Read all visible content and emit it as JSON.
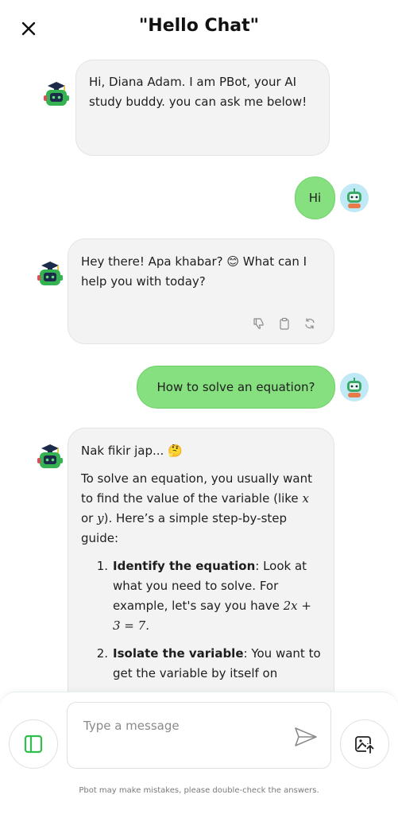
{
  "header": {
    "title": "\"Hello Chat\""
  },
  "messages": {
    "bot1": {
      "text": "Hi, Diana Adam. I am PBot, your AI study buddy.  you can ask me below!"
    },
    "user1": {
      "text": "Hi"
    },
    "bot2": {
      "text": "Hey there! Apa khabar? 😊 What can I help you with today?"
    },
    "user2": {
      "text": "How to solve an equation?"
    },
    "bot3": {
      "thinking": "Nak fikir jap... 🤔",
      "intro_a": "To solve an equation, you usually want to find the value of the variable (like ",
      "var_x": "x",
      "or": " or ",
      "var_y": "y",
      "intro_b": "). Here’s a simple step-by-step guide:",
      "steps": [
        {
          "num": "1.",
          "title": "Identify the equation",
          "body": ": Look at what you need to solve. For example, let's say you have ",
          "equation": "2x + 3 = 7."
        },
        {
          "num": "2.",
          "title": "Isolate the variable",
          "body": ": You want to get the variable by itself on"
        }
      ]
    }
  },
  "composer": {
    "placeholder": "Type a message",
    "disclaimer": "Pbot may make mistakes, please double-check the answers."
  },
  "colors": {
    "user_bubble": "#86e07f",
    "bot_bubble": "#f3f3f3",
    "accent_green": "#2fbf4a"
  },
  "icons": [
    "close-icon",
    "bot-avatar",
    "user-avatar",
    "thumbs-down-icon",
    "copy-icon",
    "regenerate-icon",
    "sidebar-icon",
    "send-icon",
    "image-upload-icon"
  ]
}
